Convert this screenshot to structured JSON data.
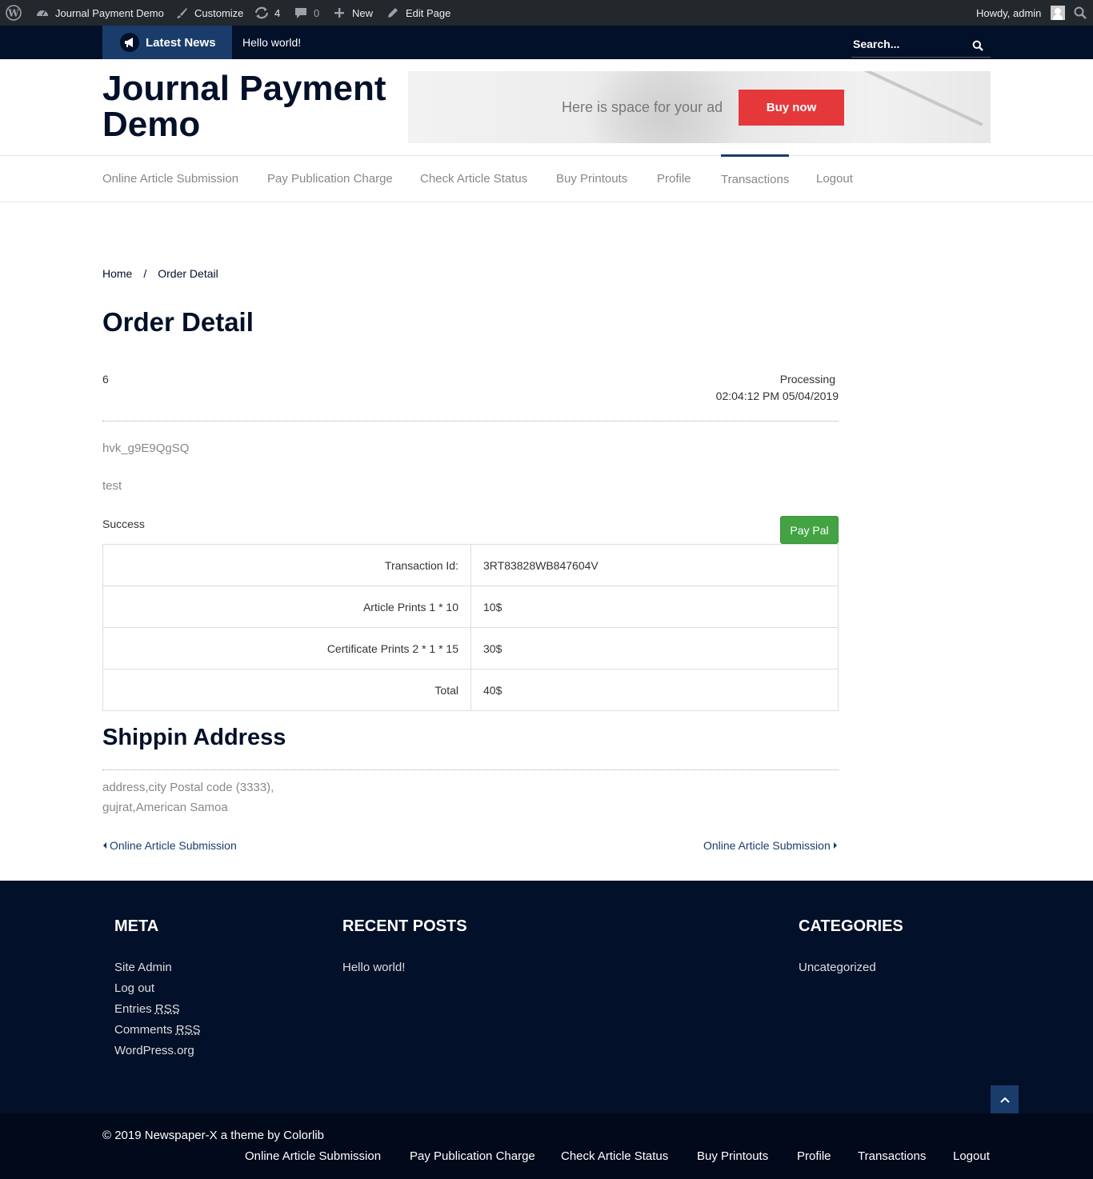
{
  "admin_bar": {
    "site_name": "Journal Payment Demo",
    "customize": "Customize",
    "updates_count": "4",
    "comments_count": "0",
    "new_label": "New",
    "edit_page": "Edit Page",
    "howdy": "Howdy, admin"
  },
  "news_bar": {
    "latest_label": "Latest News",
    "headline": "Hello world!",
    "search_placeholder": "Search..."
  },
  "header": {
    "site_title": "Journal Payment Demo",
    "ad_text": "Here is space for your ad",
    "ad_button": "Buy now"
  },
  "main_nav": {
    "items": [
      "Online Article Submission",
      "Pay Publication Charge",
      "Check Article Status",
      "Buy Printouts",
      "Profile",
      "Transactions",
      "Logout"
    ],
    "active": "Transactions"
  },
  "breadcrumb": {
    "home": "Home",
    "separator": "/",
    "current": "Order Detail"
  },
  "page_title": "Order Detail",
  "order": {
    "id": "6",
    "status": "Processing",
    "datetime": "02:04:12 PM 05/04/2019",
    "code": "hvk_g9E9QgSQ",
    "note": "test",
    "payment_status": "Success",
    "payment_method": "Pay Pal"
  },
  "items_table": [
    {
      "label": "Transaction Id:",
      "value": "3RT83828WB847604V"
    },
    {
      "label": "Article Prints 1 * 10",
      "value": "10$"
    },
    {
      "label": "Certificate Prints 2 * 1 * 15",
      "value": "30$"
    },
    {
      "label": "Total",
      "value": "40$"
    }
  ],
  "shipping": {
    "title": "Shippin Address",
    "line1": "address,city Postal code (3333),",
    "line2": "gujrat,American Samoa"
  },
  "post_nav": {
    "prev": "Online Article Submission",
    "next": "Online Article Submission"
  },
  "footer": {
    "meta_title": "META",
    "meta_links": {
      "site_admin": "Site Admin",
      "log_out": "Log out",
      "entries": "Entries",
      "comments": "Comments",
      "rss": "RSS",
      "wordpress": "WordPress.org"
    },
    "recent_title": "RECENT POSTS",
    "recent_post": "Hello world!",
    "categories_title": "CATEGORIES",
    "category": "Uncategorized"
  },
  "bottom": {
    "copyright": "© 2019 Newspaper-X a theme by Colorlib",
    "nav": [
      "Online Article Submission",
      "Pay Publication Charge",
      "Check Article Status",
      "Buy Printouts",
      "Profile",
      "Transactions",
      "Logout"
    ]
  },
  "colors": {
    "navy": "#03102a",
    "accent_blue": "#1a3c6b",
    "ad_button_red": "#e5383b",
    "paypal_green": "#43a343"
  }
}
